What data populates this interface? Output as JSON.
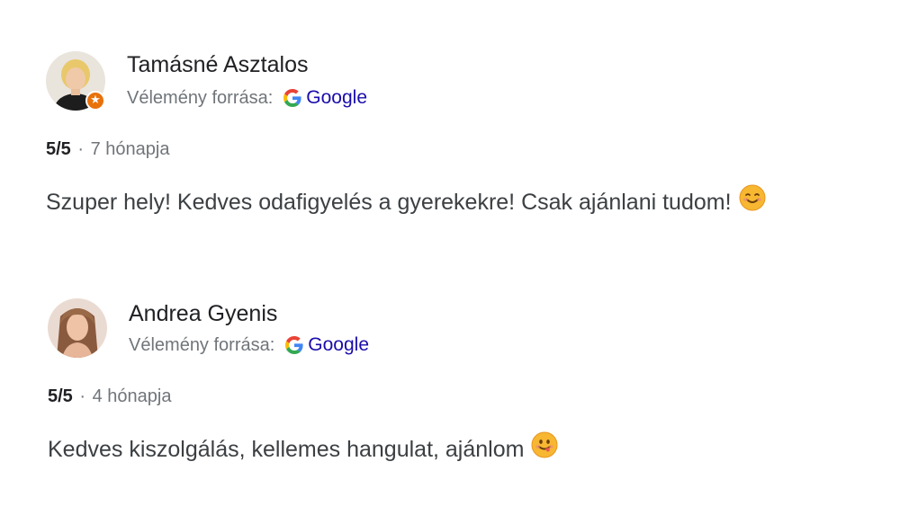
{
  "reviews": [
    {
      "author": "Tamásné Asztalos",
      "source_label": "Vélemény forrása:",
      "source_name": "Google",
      "rating": "5/5",
      "separator": "·",
      "time": "7 hónapja",
      "text": "Szuper hely! Kedves odafigyelés a gyerekekre! Csak ajánlani tudom!",
      "emoji": "smiling-face-with-smiling-eyes",
      "local_guide_badge": "★",
      "rating_value": 5,
      "rating_max": 5
    },
    {
      "author": "Andrea Gyenis",
      "source_label": "Vélemény forrása:",
      "source_name": "Google",
      "rating": "5/5",
      "separator": "·",
      "time": "4 hónapja",
      "text": "Kedves kiszolgálás, kellemes hangulat, ajánlom",
      "emoji": "smiling-face-with-tongue",
      "rating_value": 5,
      "rating_max": 5
    }
  ],
  "colors": {
    "link": "#1a0dab",
    "muted": "#70757a",
    "badge": "#e8710a"
  }
}
